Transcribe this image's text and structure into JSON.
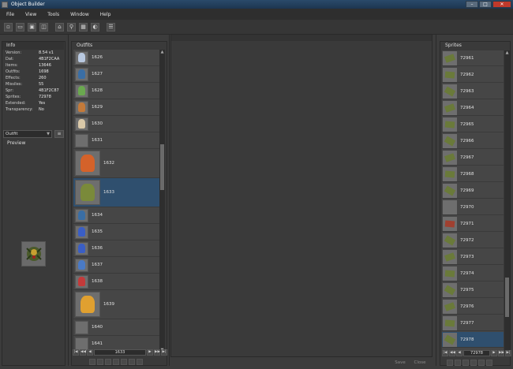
{
  "window": {
    "title": "Object Builder"
  },
  "menu": [
    "File",
    "View",
    "Tools",
    "Window",
    "Help"
  ],
  "info": {
    "header": "Info",
    "rows": [
      {
        "key": "Version:",
        "value": "8.54 v1"
      },
      {
        "key": "Dat:",
        "value": "4B1F2CAA"
      },
      {
        "key": "Items:",
        "value": "13646"
      },
      {
        "key": "Outfits:",
        "value": "1698"
      },
      {
        "key": "Effects:",
        "value": "260"
      },
      {
        "key": "Missiles:",
        "value": "55"
      },
      {
        "key": "Spr:",
        "value": "4B1F2C87"
      },
      {
        "key": "Sprites:",
        "value": "72978"
      },
      {
        "key": "Extended:",
        "value": "Yes"
      },
      {
        "key": "Transparency:",
        "value": "No"
      }
    ]
  },
  "type_select": {
    "value": "Outfit"
  },
  "preview": {
    "header": "Preview"
  },
  "outfits": {
    "header": "Outfits",
    "rows": [
      {
        "id": "1626",
        "color": "#b8c8e0"
      },
      {
        "id": "1627",
        "color": "#3a6ea5"
      },
      {
        "id": "1628",
        "color": "#6aa84f"
      },
      {
        "id": "1629",
        "color": "#c47a3a"
      },
      {
        "id": "1630",
        "color": "#d9c8a8"
      },
      {
        "id": "1631",
        "color": ""
      },
      {
        "id": "1632",
        "color": "#d4622a"
      },
      {
        "id": "1633",
        "color": "#7a8a3a"
      },
      {
        "id": "1634",
        "color": "#3a6ea5"
      },
      {
        "id": "1635",
        "color": "#3a5ec5"
      },
      {
        "id": "1636",
        "color": "#3a5ec5"
      },
      {
        "id": "1637",
        "color": "#4a7ac5"
      },
      {
        "id": "1638",
        "color": "#c43a3a"
      },
      {
        "id": "1639",
        "color": "#e0a030"
      },
      {
        "id": "1640",
        "color": ""
      },
      {
        "id": "1641",
        "color": ""
      }
    ],
    "selected": "1633",
    "pager_value": "1633"
  },
  "sprites": {
    "header": "Sprites",
    "rows": [
      "72961",
      "72962",
      "72963",
      "72964",
      "72965",
      "72966",
      "72967",
      "72968",
      "72969",
      "72970",
      "72971",
      "72972",
      "72973",
      "72974",
      "72975",
      "72976",
      "72977",
      "72978"
    ],
    "selected": "72978",
    "pager_value": "72978"
  },
  "buttons": {
    "save": "Save",
    "close": "Close"
  },
  "icons": [
    "new-file-icon",
    "open-folder-icon",
    "compile-icon",
    "merge-icon",
    "find-icon",
    "search-icon",
    "animation-editor-icon",
    "sprite-viewer-icon",
    "settings-icon"
  ]
}
